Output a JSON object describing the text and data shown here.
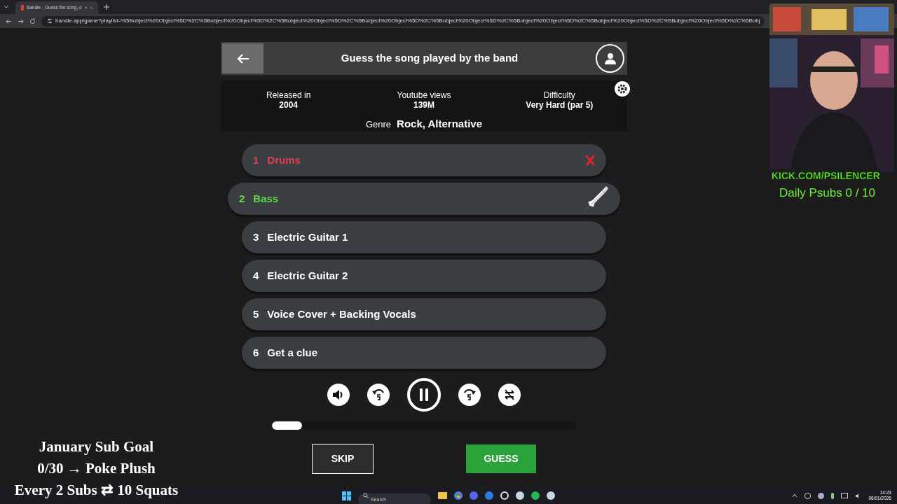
{
  "browser": {
    "tab_title": "Bandle - Guess the song, o",
    "url": "bandle.app/game?playlist=%5Bobject%20Object%5D%2C%5Bobject%20Object%5D%2C%5Bobject%20Object%5D%2C%5Bobject%20Object%5D%2C%5Bobject%20Object%5D%2C%5Bobject%20Object%5D%2C%5Bobject%20Object%5D%2C%5Bobject%20Object%5D%2C%5Bobj"
  },
  "header": {
    "title": "Guess the song played by the band"
  },
  "info": [
    {
      "label": "Released in",
      "value": "2004"
    },
    {
      "label": "Youtube views",
      "value": "139M"
    },
    {
      "label": "Difficulty",
      "value": "Very Hard (par 5)"
    }
  ],
  "genre": {
    "label": "Genre",
    "value": "Rock, Alternative"
  },
  "clues": [
    {
      "number": "1",
      "label": "Drums",
      "kind": "wrong"
    },
    {
      "number": "2",
      "label": "Bass",
      "kind": "active"
    },
    {
      "number": "3",
      "label": "Electric Guitar 1",
      "kind": "pending"
    },
    {
      "number": "4",
      "label": "Electric Guitar 2",
      "kind": "pending"
    },
    {
      "number": "5",
      "label": "Voice Cover + Backing Vocals",
      "kind": "pending"
    },
    {
      "number": "6",
      "label": "Get a clue",
      "kind": "pending"
    }
  ],
  "player": {
    "playing": true,
    "level": 0.1
  },
  "buttons": {
    "skip": "SKIP",
    "guess": "GUESS"
  },
  "overlay": {
    "channel": "KICK.COM/PSILENCER",
    "daily": "Daily Psubs 0 / 10",
    "goal": [
      "January Sub Goal",
      "0/30 → Poke Plush",
      "Every 2 Subs ⇄ 10 Squats"
    ]
  },
  "taskbar": {
    "search_placeholder": "Search",
    "time": "14:23",
    "date": "06/01/2026"
  }
}
